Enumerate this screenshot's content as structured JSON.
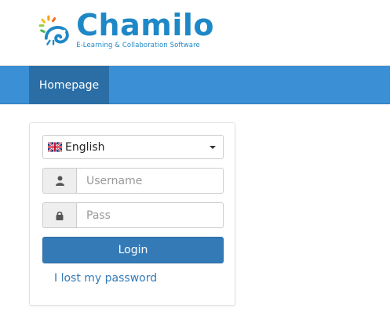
{
  "brand": {
    "name": "Chamilo",
    "tagline": "E-Learning & Collaboration Software",
    "color": "#1e88c7"
  },
  "nav": {
    "items": [
      {
        "label": "Homepage",
        "active": true
      }
    ],
    "bar_color": "#3a8fd5",
    "active_color": "#2b6ea6"
  },
  "login": {
    "language": {
      "selected": "English",
      "flag_icon": "uk-flag-icon"
    },
    "username": {
      "placeholder": "Username",
      "value": "",
      "icon": "user-icon"
    },
    "password": {
      "placeholder": "Pass",
      "value": "",
      "icon": "lock-icon"
    },
    "submit_label": "Login",
    "lost_password_label": "I lost my password",
    "button_color": "#337ab7"
  }
}
